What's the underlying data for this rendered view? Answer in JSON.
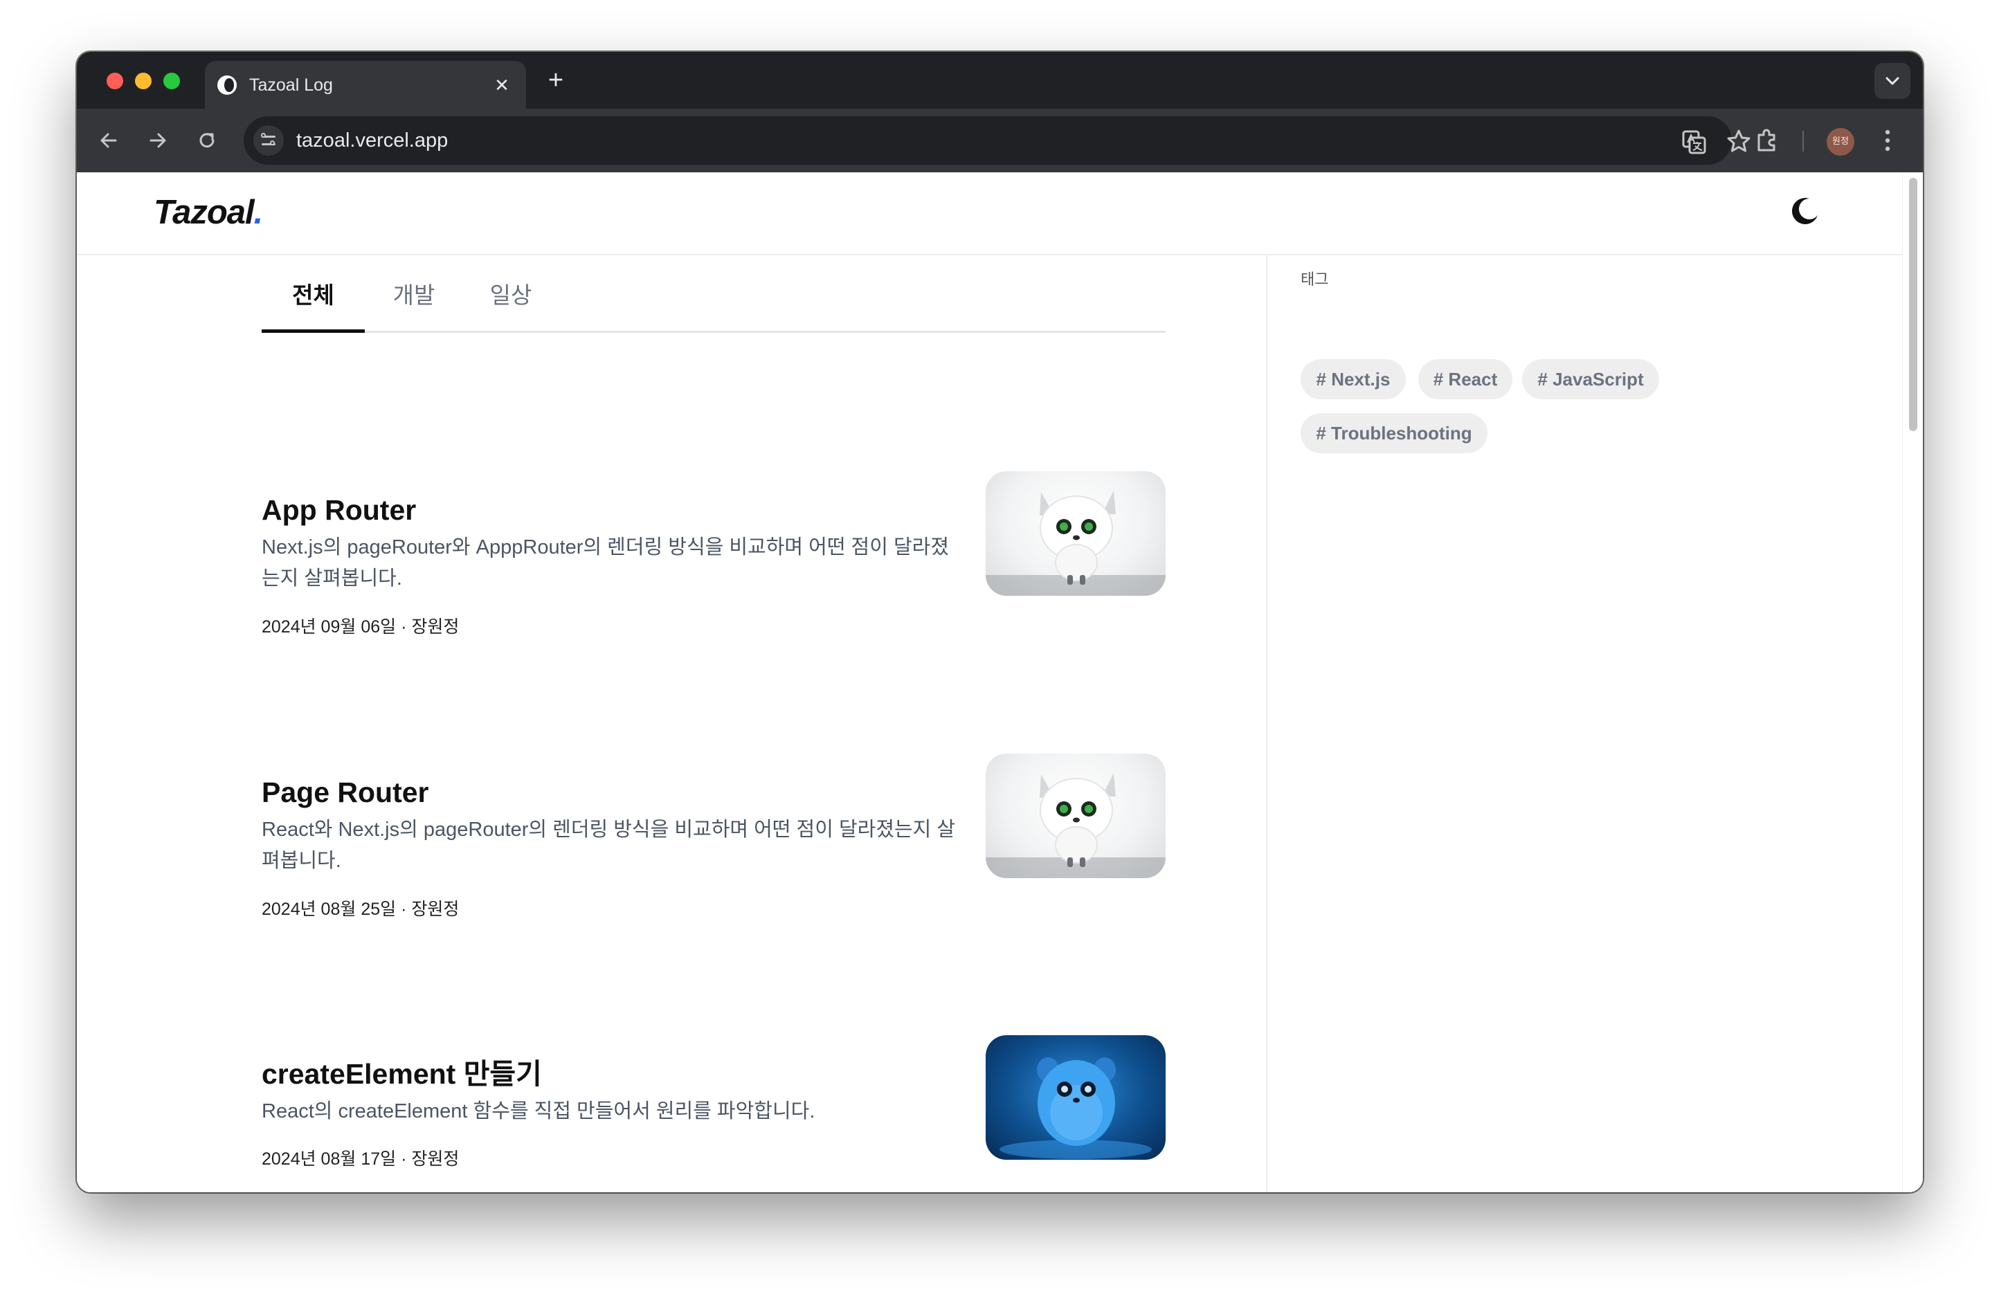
{
  "browser": {
    "tab": {
      "title": "Tazoal Log",
      "close_glyph": "✕"
    },
    "new_tab_glyph": "+",
    "address": {
      "url": "tazoal.vercel.app"
    },
    "profile_avatar": "원정",
    "icons": {
      "back": "arrow-left-icon",
      "forward": "arrow-right-icon",
      "reload": "reload-icon",
      "site_info": "tune-icon",
      "translate": "translate-icon",
      "bookmark": "star-icon",
      "extensions": "puzzle-icon",
      "menu": "kebab-menu-icon",
      "tab_search": "chevron-down-icon"
    }
  },
  "site": {
    "logo": {
      "text": "Tazoal",
      "dot": "."
    },
    "theme_toggle": "moon-icon",
    "colors": {
      "accent": "#2563eb",
      "text": "#111111",
      "muted": "#4b5563",
      "tag_bg": "#eeeeee"
    }
  },
  "categories": {
    "tabs": [
      {
        "label": "전체",
        "active": true
      },
      {
        "label": "개발",
        "active": false
      },
      {
        "label": "일상",
        "active": false
      }
    ]
  },
  "posts": [
    {
      "title": "App Router",
      "description": "Next.js의 pageRouter와 ApppRouter의 렌더링 방식을 비교하며 어떤 점이 달라졌는지 살펴봅니다.",
      "meta": "2024년 09월 06일 · 장원정",
      "thumbnail": "white-fluffy-creature"
    },
    {
      "title": "Page Router",
      "description": "React와 Next.js의 pageRouter의 렌더링 방식을 비교하며 어떤 점이 달라졌는지 살펴봅니다.",
      "meta": "2024년 08월 25일 · 장원정",
      "thumbnail": "white-fluffy-creature"
    },
    {
      "title": "createElement 만들기",
      "description": "React의 createElement 함수를 직접 만들어서 원리를 파악합니다.",
      "meta": "2024년 08월 17일 · 장원정",
      "thumbnail": "blue-fluffy-creature"
    }
  ],
  "sidebar": {
    "heading": "태그",
    "tags": [
      "# Next.js",
      "# React",
      "# JavaScript",
      "# Troubleshooting"
    ]
  }
}
